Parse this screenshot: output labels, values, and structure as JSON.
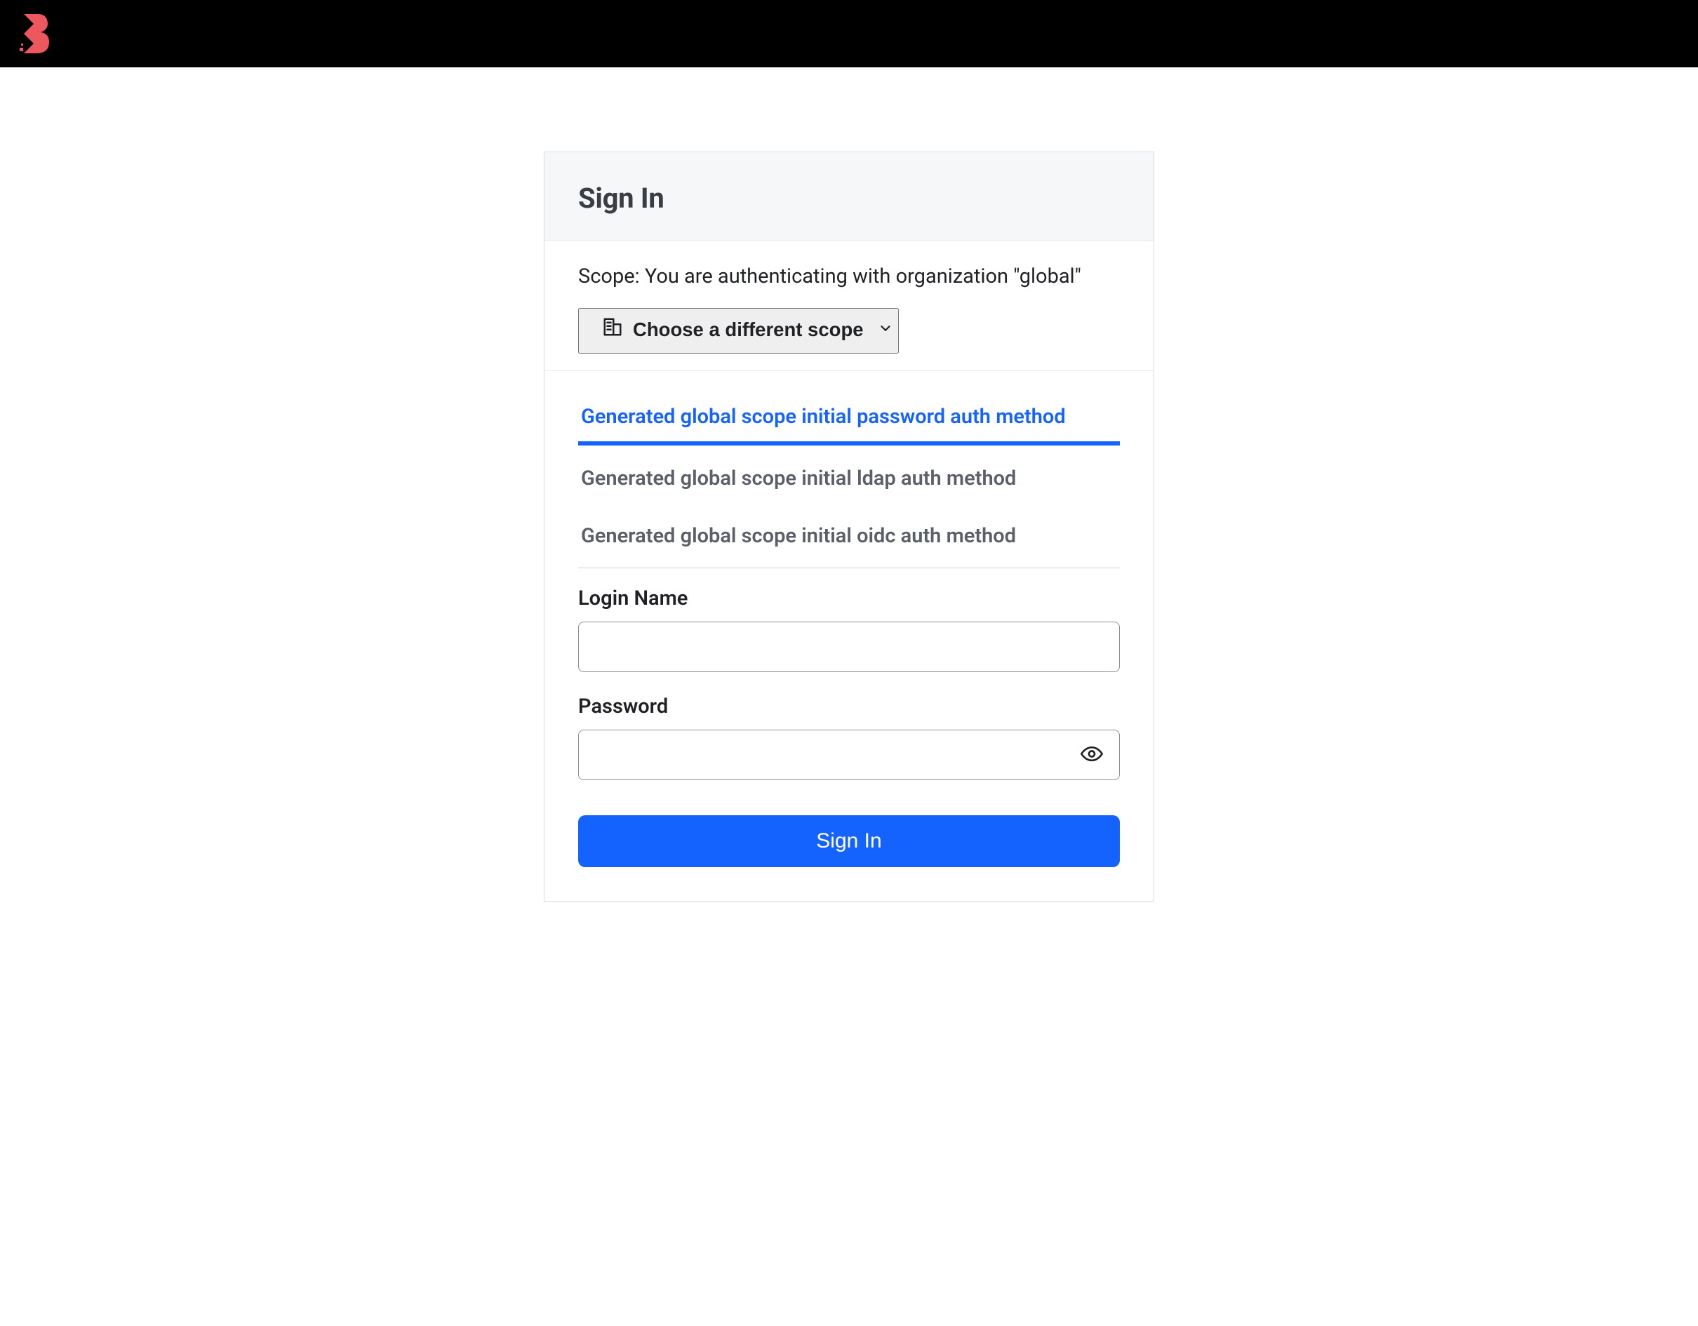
{
  "header": {
    "title": "Sign In"
  },
  "scope": {
    "message": "Scope: You are authenticating with organization \"global\"",
    "choose_label": "Choose a different scope"
  },
  "auth_methods": {
    "tabs": [
      {
        "label": "Generated global scope initial password auth method",
        "active": true
      },
      {
        "label": "Generated global scope initial ldap auth method",
        "active": false
      },
      {
        "label": "Generated global scope initial oidc auth method",
        "active": false
      }
    ]
  },
  "form": {
    "login_label": "Login Name",
    "login_value": "",
    "password_label": "Password",
    "password_value": "",
    "submit_label": "Sign In"
  },
  "icons": {
    "org": "org-icon",
    "chevron_down": "chevron-down-icon",
    "eye": "eye-icon"
  },
  "colors": {
    "accent": "#1563ff",
    "logo": "#ec585d"
  }
}
